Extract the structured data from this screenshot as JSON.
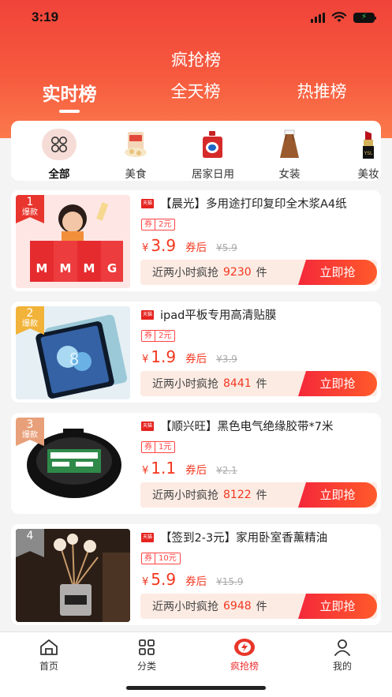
{
  "status": {
    "time": "3:19"
  },
  "page": {
    "title": "疯抢榜"
  },
  "tabs": [
    {
      "label": "实时榜",
      "active": true
    },
    {
      "label": "全天榜",
      "active": false
    },
    {
      "label": "热推榜",
      "active": false
    }
  ],
  "categories": [
    {
      "label": "全部",
      "icon": "grid-icon",
      "active": true
    },
    {
      "label": "美食",
      "icon": "snack-icon"
    },
    {
      "label": "居家日用",
      "icon": "detergent-icon"
    },
    {
      "label": "女装",
      "icon": "dress-icon"
    },
    {
      "label": "美妆",
      "icon": "lipstick-icon"
    }
  ],
  "products": [
    {
      "rank": "1",
      "rank_tag": "爆款",
      "store_badge": "天猫",
      "title": "【晨光】多用途打印复印全木浆A4纸",
      "coupon_label": "券",
      "coupon_value": "2元",
      "yen": "¥",
      "price": "3.9",
      "after_label": "券后",
      "original": "¥5.9",
      "sold_prefix": "近两小时疯抢",
      "sold_count": "9230",
      "sold_unit": "件",
      "buy_label": "立即抢",
      "rank_color": "#e8352e"
    },
    {
      "rank": "2",
      "rank_tag": "爆款",
      "store_badge": "天猫",
      "title": "ipad平板专用高清贴膜",
      "coupon_label": "券",
      "coupon_value": "2元",
      "yen": "¥",
      "price": "1.9",
      "after_label": "券后",
      "original": "¥3.9",
      "sold_prefix": "近两小时疯抢",
      "sold_count": "8441",
      "sold_unit": "件",
      "buy_label": "立即抢",
      "rank_color": "#f2b33a"
    },
    {
      "rank": "3",
      "rank_tag": "爆款",
      "store_badge": "天猫",
      "title": "【顺兴旺】黑色电气绝缘胶带*7米",
      "coupon_label": "券",
      "coupon_value": "1元",
      "yen": "¥",
      "price": "1.1",
      "after_label": "券后",
      "original": "¥2.1",
      "sold_prefix": "近两小时疯抢",
      "sold_count": "8122",
      "sold_unit": "件",
      "buy_label": "立即抢",
      "rank_color": "#e8a07a"
    },
    {
      "rank": "4",
      "rank_tag": "",
      "store_badge": "天猫",
      "title": "【签到2-3元】家用卧室香薰精油",
      "coupon_label": "券",
      "coupon_value": "10元",
      "yen": "¥",
      "price": "5.9",
      "after_label": "券后",
      "original": "¥15.9",
      "sold_prefix": "近两小时疯抢",
      "sold_count": "6948",
      "sold_unit": "件",
      "buy_label": "立即抢",
      "rank_color": "#8a8a8a"
    }
  ],
  "bottom_nav": [
    {
      "label": "首页",
      "icon": "home-icon"
    },
    {
      "label": "分类",
      "icon": "category-icon"
    },
    {
      "label": "疯抢榜",
      "icon": "flash-icon",
      "active": true
    },
    {
      "label": "我的",
      "icon": "profile-icon"
    }
  ],
  "colors": {
    "accent": "#f2371f",
    "header_top": "#f0433a",
    "header_bottom": "#fb7a4c"
  }
}
